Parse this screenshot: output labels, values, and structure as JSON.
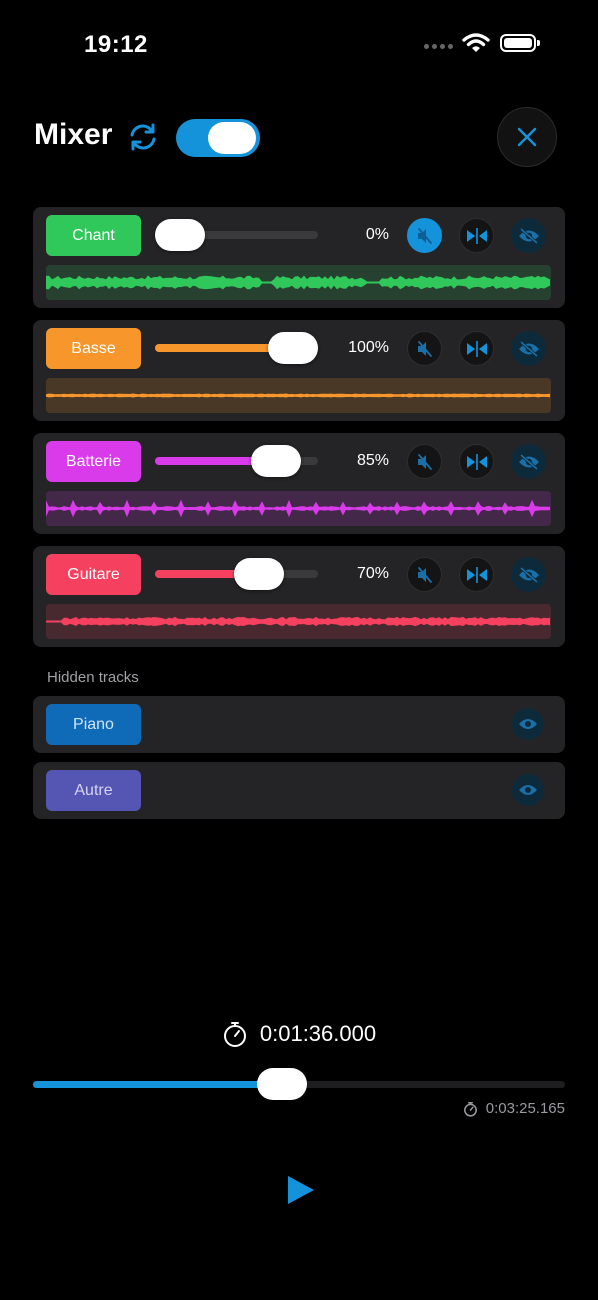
{
  "status_bar": {
    "time": "19:12"
  },
  "header": {
    "title": "Mixer"
  },
  "tracks": [
    {
      "name": "Chant",
      "color": "#30c85a",
      "volume_percent": 0,
      "volume_label": "0%",
      "muted": true,
      "waveform": "vocal"
    },
    {
      "name": "Basse",
      "color": "#f7962a",
      "volume_percent": 100,
      "volume_label": "100%",
      "muted": false,
      "waveform": "flat"
    },
    {
      "name": "Batterie",
      "color": "#d93bea",
      "volume_percent": 85,
      "volume_label": "85%",
      "muted": false,
      "waveform": "drums"
    },
    {
      "name": "Guitare",
      "color": "#f5415f",
      "volume_percent": 70,
      "volume_label": "70%",
      "muted": false,
      "waveform": "guitar"
    }
  ],
  "hidden_section": {
    "label": "Hidden tracks",
    "tracks": [
      {
        "name": "Piano",
        "color": "#0f6bb8"
      },
      {
        "name": "Autre",
        "color": "#5555b3"
      }
    ]
  },
  "transport": {
    "position": "0:01:36.000",
    "duration": "0:03:25.165",
    "progress_fraction": 0.468
  },
  "icons": {
    "sync": "sync-icon",
    "close": "close-icon",
    "mute": "speaker-muted-icon",
    "solo": "solo-icon",
    "visibility": "eye-slash-icon",
    "show": "eye-icon",
    "timer": "stopwatch-icon",
    "play": "play-icon"
  },
  "accent_color": "#1493db"
}
